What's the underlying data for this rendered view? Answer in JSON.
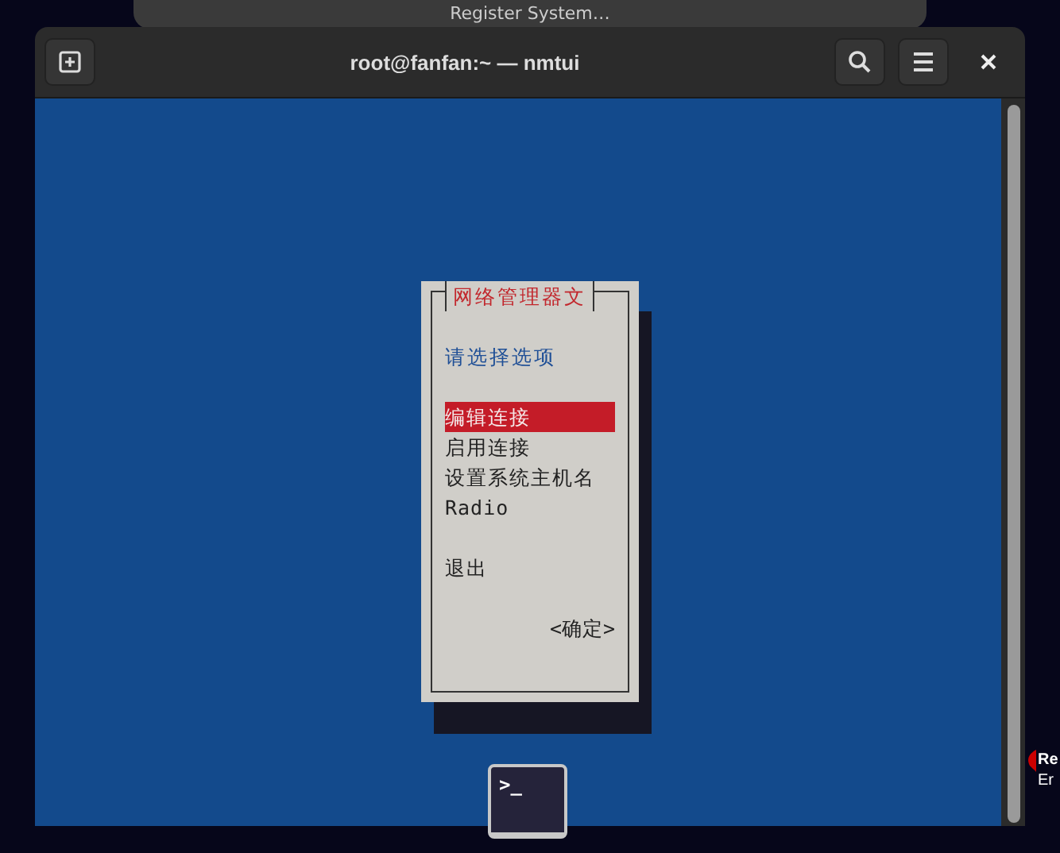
{
  "notification": {
    "text": "Register System…"
  },
  "window": {
    "title": "root@fanfan:~ — nmtui"
  },
  "dialog": {
    "title": "网络管理器文",
    "prompt": "请选择选项",
    "items": [
      {
        "label": "编辑连接",
        "selected": true
      },
      {
        "label": "启用连接",
        "selected": false
      },
      {
        "label": "设置系统主机名",
        "selected": false
      },
      {
        "label": "Radio",
        "selected": false
      },
      {
        "label": "退出",
        "selected": false
      }
    ],
    "ok_button": "<确定>"
  },
  "dock": {
    "terminal_glyph": ">_"
  },
  "desktop_label": {
    "line_1": "Re",
    "line_2": "Er"
  }
}
